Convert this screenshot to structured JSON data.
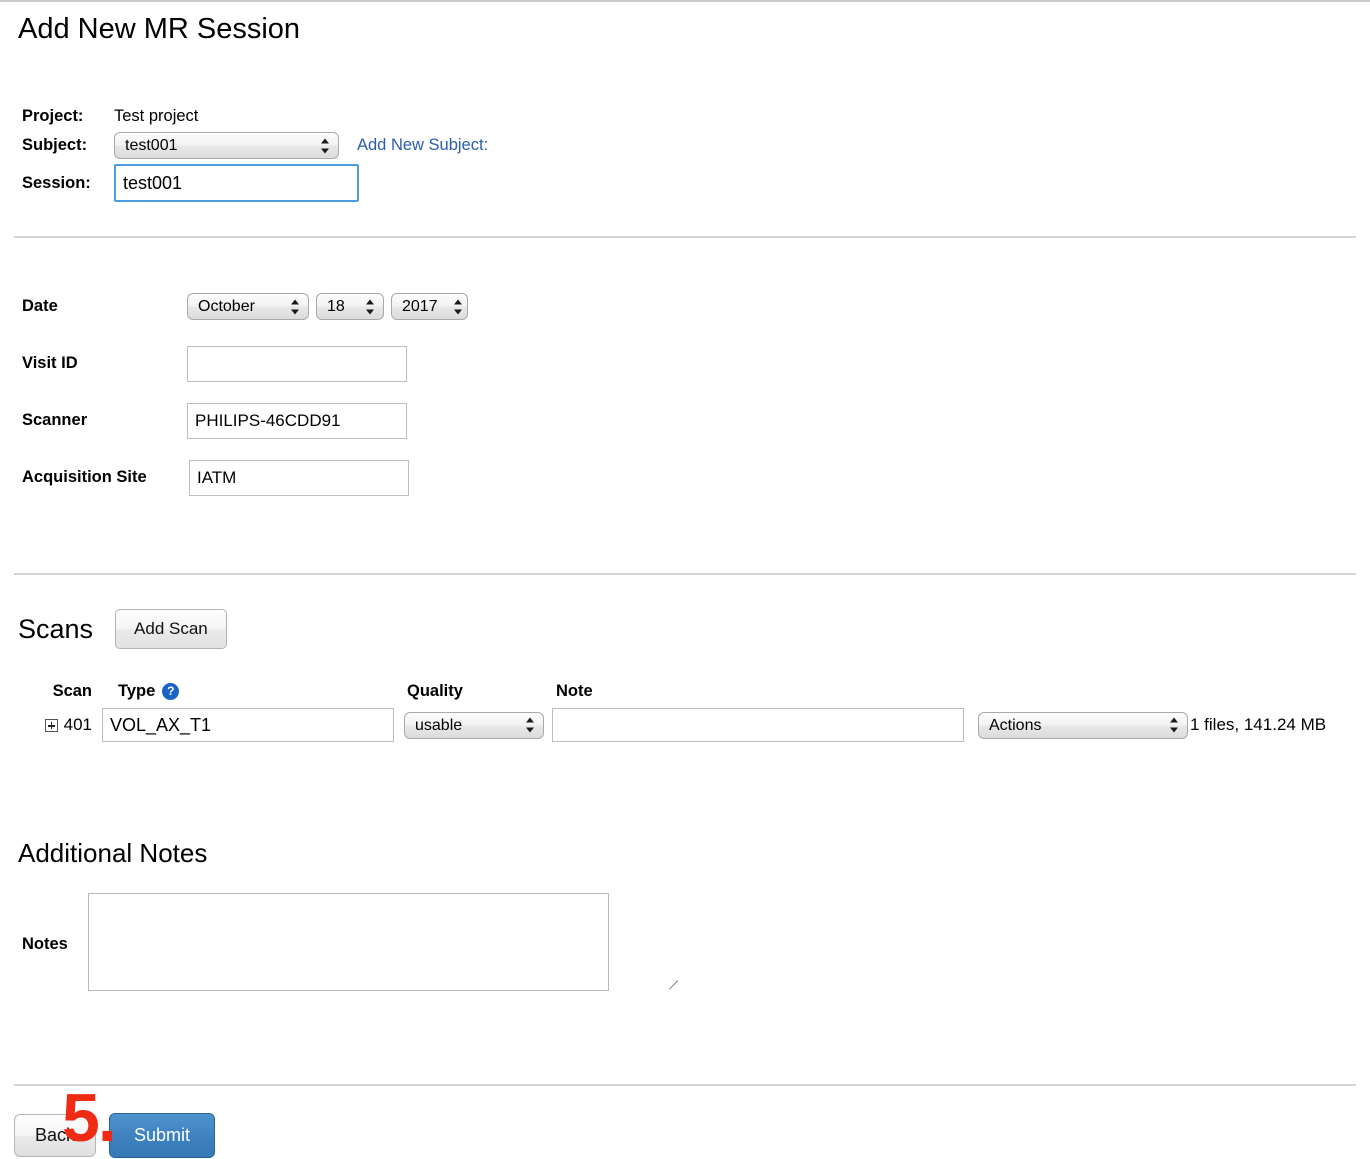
{
  "page": {
    "title": "Add New MR Session"
  },
  "header": {
    "project": {
      "label": "Project:",
      "value": "Test project"
    },
    "subject": {
      "label": "Subject:",
      "value": "test001",
      "options": [
        "test001"
      ],
      "add_link": "Add New Subject:"
    },
    "session": {
      "label": "Session:",
      "value": "test001",
      "placeholder": ""
    }
  },
  "details": {
    "date": {
      "label": "Date",
      "month": "October",
      "day": "18",
      "year": "2017",
      "month_options": [
        "October"
      ],
      "day_options": [
        "18"
      ],
      "year_options": [
        "2017"
      ]
    },
    "visit_id": {
      "label": "Visit ID",
      "value": "",
      "placeholder": ""
    },
    "scanner": {
      "label": "Scanner",
      "value": "PHILIPS-46CDD91",
      "placeholder": ""
    },
    "acquisition_site": {
      "label": "Acquisition Site",
      "value": "IATM",
      "placeholder": ""
    }
  },
  "scans": {
    "title": "Scans",
    "add_button": "Add Scan",
    "help_icon": "help-icon",
    "columns": [
      "Scan",
      "Type",
      "Quality",
      "Note"
    ],
    "rows": [
      {
        "id": "401",
        "type": "VOL_AX_T1",
        "quality": "usable",
        "quality_options": [
          "usable"
        ],
        "note": "",
        "note_placeholder": "",
        "actions": "Actions",
        "actions_options": [
          "Actions"
        ],
        "files": "1 files, 141.24 MB"
      }
    ]
  },
  "notes": {
    "title": "Additional Notes",
    "label": "Notes",
    "value": "",
    "placeholder": ""
  },
  "footer": {
    "back_label": "Back",
    "submit_label": "Submit"
  },
  "annotation": {
    "step": "5."
  },
  "colors": {
    "link": "#2a5db0",
    "submit": "#3d81bf",
    "help_icon": "#1b63c4",
    "annotation": "#f02b14",
    "focus_border": "#4a9fe0"
  }
}
